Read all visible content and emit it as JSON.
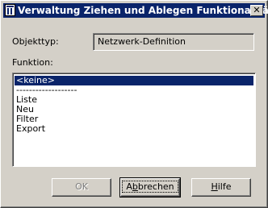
{
  "window": {
    "title": "Verwaltung Ziehen und Ablegen Funktionalität",
    "close_glyph": "✕"
  },
  "form": {
    "objekttyp_label": "Objekttyp:",
    "objekttyp_value": "Netzwerk-Definition",
    "funktion_label": "Funktion:"
  },
  "list": {
    "items": [
      "<keine>",
      "-------------------",
      "Liste",
      "Neu",
      "Filter",
      "Export"
    ],
    "selected_index": 0
  },
  "buttons": {
    "ok": "OK",
    "abbrechen_pre": "A",
    "abbrechen_ul": "b",
    "abbrechen_post": "brechen",
    "hilfe_ul": "H",
    "hilfe_post": "ilfe"
  }
}
